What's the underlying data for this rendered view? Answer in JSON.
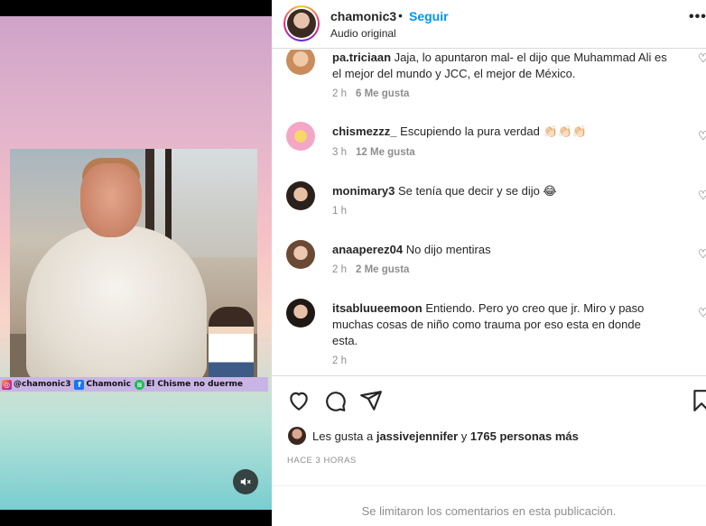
{
  "header": {
    "username": "chamonic3",
    "separator": "•",
    "follow_label": "Seguir",
    "subtitle": "Audio original",
    "more_icon": "more-horizontal-icon"
  },
  "media": {
    "overlay_instagram": "@chamonic3",
    "overlay_facebook": "Chamonic",
    "overlay_spotify": "El Chisme no duerme",
    "mute_icon": "volume-muted-icon"
  },
  "comments": [
    {
      "username": "pa.triciaan",
      "text": "Jaja, lo apuntaron mal- el dijo que Muhammad Ali es el mejor del mundo y JCC, el mejor de México.",
      "time": "2 h",
      "likes": "6 Me gusta"
    },
    {
      "username": "chismezzz_",
      "text": "Escupiendo la pura verdad 👏🏻👏🏻👏🏻",
      "time": "3 h",
      "likes": "12 Me gusta"
    },
    {
      "username": "monimary3",
      "text": "Se tenía que decir y se dijo 😂",
      "time": "1 h",
      "likes": ""
    },
    {
      "username": "anaaperez04",
      "text": "No dijo mentiras",
      "time": "2 h",
      "likes": "2 Me gusta"
    },
    {
      "username": "itsabluueemoon",
      "text": "Entiendo. Pero yo creo que jr. Miro y paso muchas cosas de niño como trauma por eso esta en donde esta.",
      "time": "2 h",
      "likes": ""
    }
  ],
  "actions": {
    "like_icon": "heart-icon",
    "comment_icon": "comment-icon",
    "share_icon": "send-icon",
    "save_icon": "bookmark-icon"
  },
  "likes": {
    "prefix": "Les gusta a",
    "user": "jassivejennifer",
    "connector": "y",
    "others": "1765 personas más"
  },
  "time_ago": "HACE 3 HORAS",
  "footer_note": "Se limitaron los comentarios en esta publicación."
}
